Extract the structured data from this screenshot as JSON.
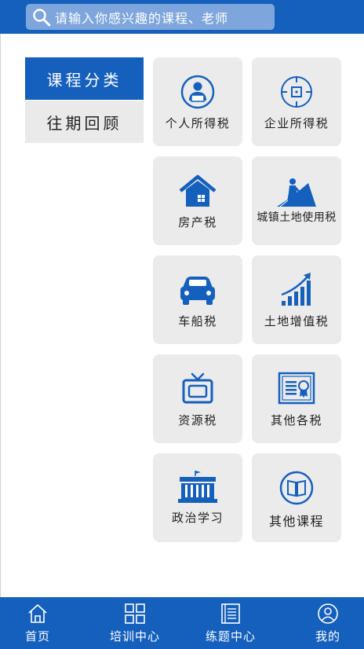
{
  "search": {
    "placeholder": "请输入你感兴趣的课程、老师",
    "icon": "search-icon"
  },
  "categories": [
    {
      "label": "课程分类",
      "active": true
    },
    {
      "label": "往期回顾",
      "active": false
    }
  ],
  "tiles": [
    {
      "label": "个人所得税",
      "icon": "person-icon"
    },
    {
      "label": "企业所得税",
      "icon": "target-icon"
    },
    {
      "label": "房产税",
      "icon": "house-icon"
    },
    {
      "label": "城镇土地使用税",
      "icon": "worker-icon"
    },
    {
      "label": "车船税",
      "icon": "car-icon"
    },
    {
      "label": "土地增值税",
      "icon": "growth-chart-icon"
    },
    {
      "label": "资源税",
      "icon": "tv-icon"
    },
    {
      "label": "其他各税",
      "icon": "certificate-icon"
    },
    {
      "label": "政治学习",
      "icon": "building-icon"
    },
    {
      "label": "其他课程",
      "icon": "book-icon"
    }
  ],
  "tabbar": [
    {
      "label": "首页",
      "icon": "home-icon"
    },
    {
      "label": "培训中心",
      "icon": "grid-icon"
    },
    {
      "label": "练题中心",
      "icon": "notebook-icon"
    },
    {
      "label": "我的",
      "icon": "user-icon"
    }
  ],
  "colors": {
    "brand": "#1560bd",
    "tile_bg": "#ebebeb",
    "icon": "#1560bd"
  }
}
